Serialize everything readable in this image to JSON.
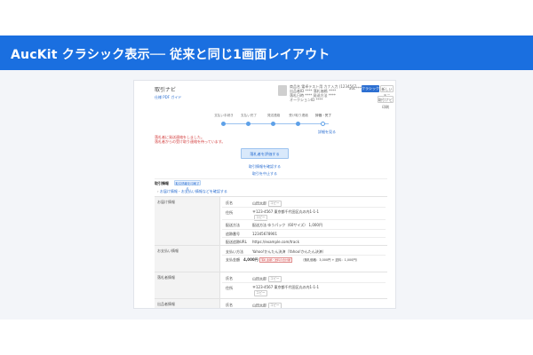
{
  "banner": {
    "title": "AucKit クラシック表示── 従来と同じ1画面レイアウト"
  },
  "page": {
    "title": "取引ナビ",
    "help_link": "仕様 PDF ガイド",
    "header_info": [
      "商品名 電卓テスト用 カナ入力 (1234567890)",
      "出品者ID ****  落札価格 ****",
      "落札日時 ****  発送方法 ****",
      "オークションID ****"
    ],
    "header_user": "auc****",
    "classic_button": "クラシック表示",
    "new_button": "新しい表示",
    "print_button": "取引ナビ印刷",
    "steps": [
      "支払い手続き",
      "支払い完了",
      "発送連絡",
      "受け取り連絡",
      "評価・完了"
    ],
    "status_link": "詳細を見る",
    "notice_line1": "落札者に発送連絡をしました。",
    "notice_line2": "落札者からの受け取り連絡を待っています。",
    "primary_action": "落札者を評価する",
    "secondary_link1": "取引情報を確認する",
    "secondary_link2": "取引を中止する",
    "section_title": "取引情報",
    "section_badge": "取引情報を印刷する",
    "expand_link": "お届け情報・お支払い情報などを確認する",
    "rows": [
      {
        "head": "お届け情報",
        "lines": [
          {
            "label": "氏名",
            "value": "山田太郎",
            "tag": "コピー"
          },
          {
            "label": "住所",
            "value": "〒123-4567 東京都千代田区丸の内1-1-1",
            "tag": "コピー"
          },
          {
            "label": "配送方法",
            "value": "配送方法 ゆうパック（60サイズ） 1,000円"
          },
          {
            "label": "追跡番号",
            "value": "12345678901"
          },
          {
            "label": "配送追跡URL",
            "value": "https://example.com/track"
          }
        ]
      },
      {
        "head": "お支払い情報",
        "lines": [
          {
            "label": "支払い方法",
            "value": "Yahoo!かんたん決済（Yahoo!かんたん決済）"
          },
          {
            "label": "支払金額",
            "value": "4,000円",
            "note": "落札金額と送料の合計額",
            "extra": "（落札価格：3,000円 + 送料：1,000円）"
          }
        ]
      },
      {
        "head": "落札者情報",
        "lines": [
          {
            "label": "氏名",
            "value": "山田太郎",
            "tag": "コピー"
          },
          {
            "label": "住所",
            "value": "〒123-4567 東京都千代田区丸の内1-1-1",
            "tag": "コピー"
          }
        ]
      },
      {
        "head": "出品者情報",
        "lines": [
          {
            "label": "氏名",
            "value": "山田太郎",
            "tag": "コピー"
          }
        ]
      }
    ]
  },
  "colors": {
    "banner": "#1a6fe0",
    "accent": "#2c6fd1",
    "alert": "#d23c3c"
  }
}
